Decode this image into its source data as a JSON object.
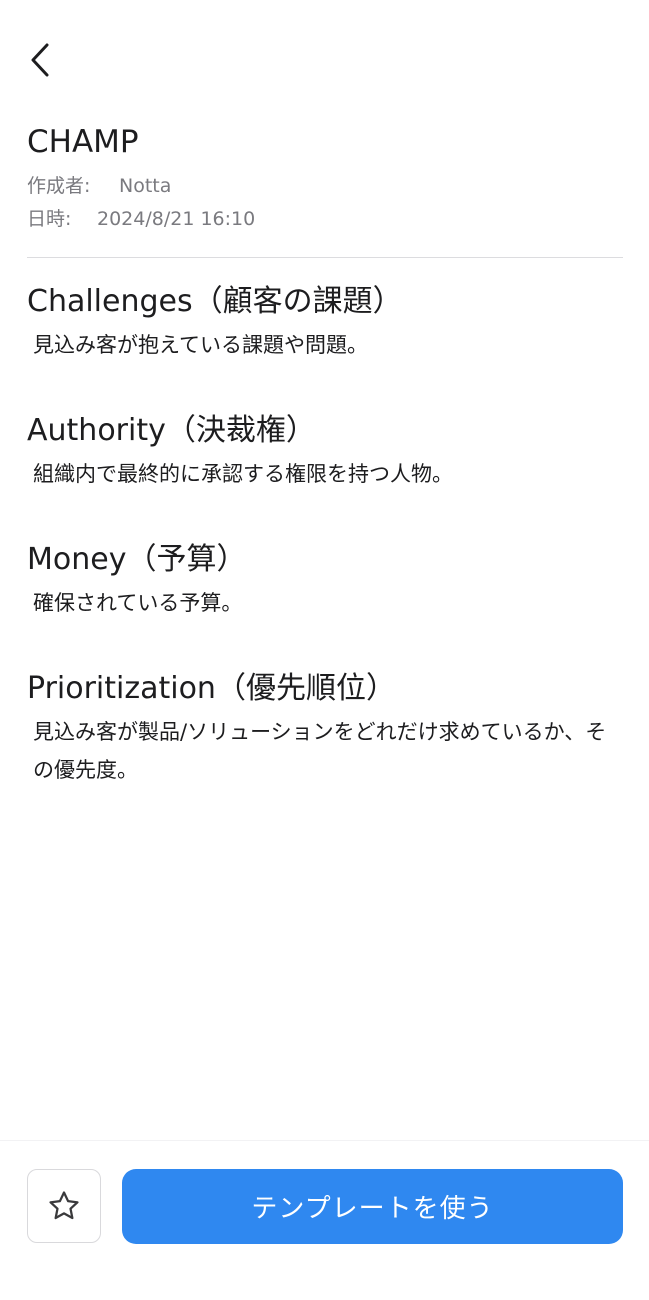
{
  "nav": {
    "back_icon": "chevron-left-icon"
  },
  "template": {
    "title": "CHAMP",
    "author_label": "作成者:",
    "author": "Notta",
    "date_label": "日時:",
    "date": "2024/8/21 16:10"
  },
  "sections": [
    {
      "title": "Challenges（顧客の課題）",
      "description": "見込み客が抱えている課題や問題。"
    },
    {
      "title": "Authority（決裁権）",
      "description": "組織内で最終的に承認する権限を持つ人物。"
    },
    {
      "title": "Money（予算）",
      "description": "確保されている予算。"
    },
    {
      "title": "Prioritization（優先順位）",
      "description": "見込み客が製品/ソリューションをどれだけ求めているか、その優先度。"
    }
  ],
  "actions": {
    "favorite_icon": "star-outline-icon",
    "use_template_label": "テンプレートを使う",
    "primary_color": "#2f88f0"
  }
}
